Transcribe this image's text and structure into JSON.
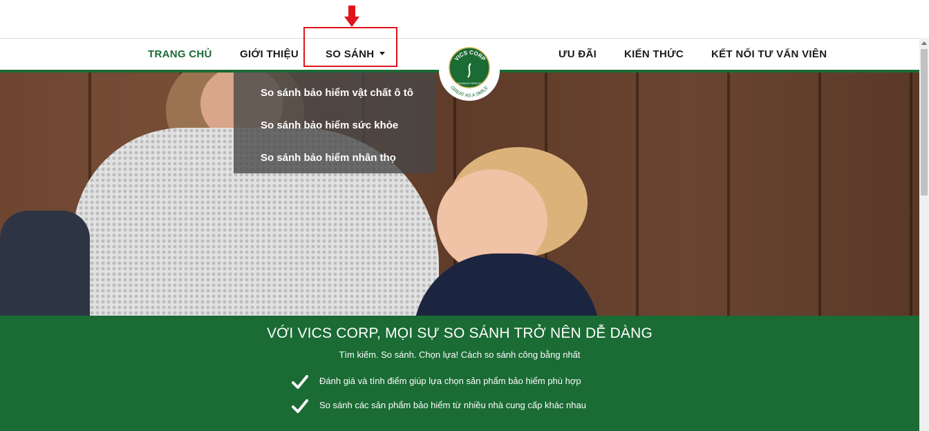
{
  "nav": {
    "items": [
      {
        "label": "TRANG CHỦ",
        "active": true
      },
      {
        "label": "GIỚI THIỆU"
      },
      {
        "label": "SO SÁNH",
        "has_dropdown": true,
        "highlighted": true
      },
      {
        "label": "ƯU ĐÃI"
      },
      {
        "label": "KIẾN THỨC"
      },
      {
        "label": "KẾT NỐI TƯ VẤN VIÊN"
      }
    ]
  },
  "logo": {
    "name": "VICS CORP",
    "tagline": "GREAT AS A SMILE",
    "sub": "INSURANCE SERVICES"
  },
  "dropdown": {
    "items": [
      {
        "label": "So sánh bảo hiểm vật chất ô tô"
      },
      {
        "label": "So sánh bảo hiểm sức khỏe"
      },
      {
        "label": "So sánh bảo hiểm nhân thọ"
      }
    ]
  },
  "green_section": {
    "headline": "VỚI VICS CORP, MỌI SỰ SO SÁNH TRỞ NÊN DỄ DÀNG",
    "subline": "Tìm kiếm. So sánh. Chọn lựa! Cách so sánh công bằng nhất",
    "features": [
      {
        "text": "Đánh giá và tính điểm giúp lựa chọn sản phẩm bảo hiểm phù hợp",
        "icon": "check-icon"
      },
      {
        "text": "So sánh các sản phẩm bảo hiểm từ nhiều nhà cung cấp khác nhau",
        "icon": "check-icon"
      }
    ]
  },
  "colors": {
    "brand_green": "#1a6b34",
    "annotation_red": "#e0141b",
    "dropdown_bg": "rgba(70,70,70,0.78)"
  }
}
